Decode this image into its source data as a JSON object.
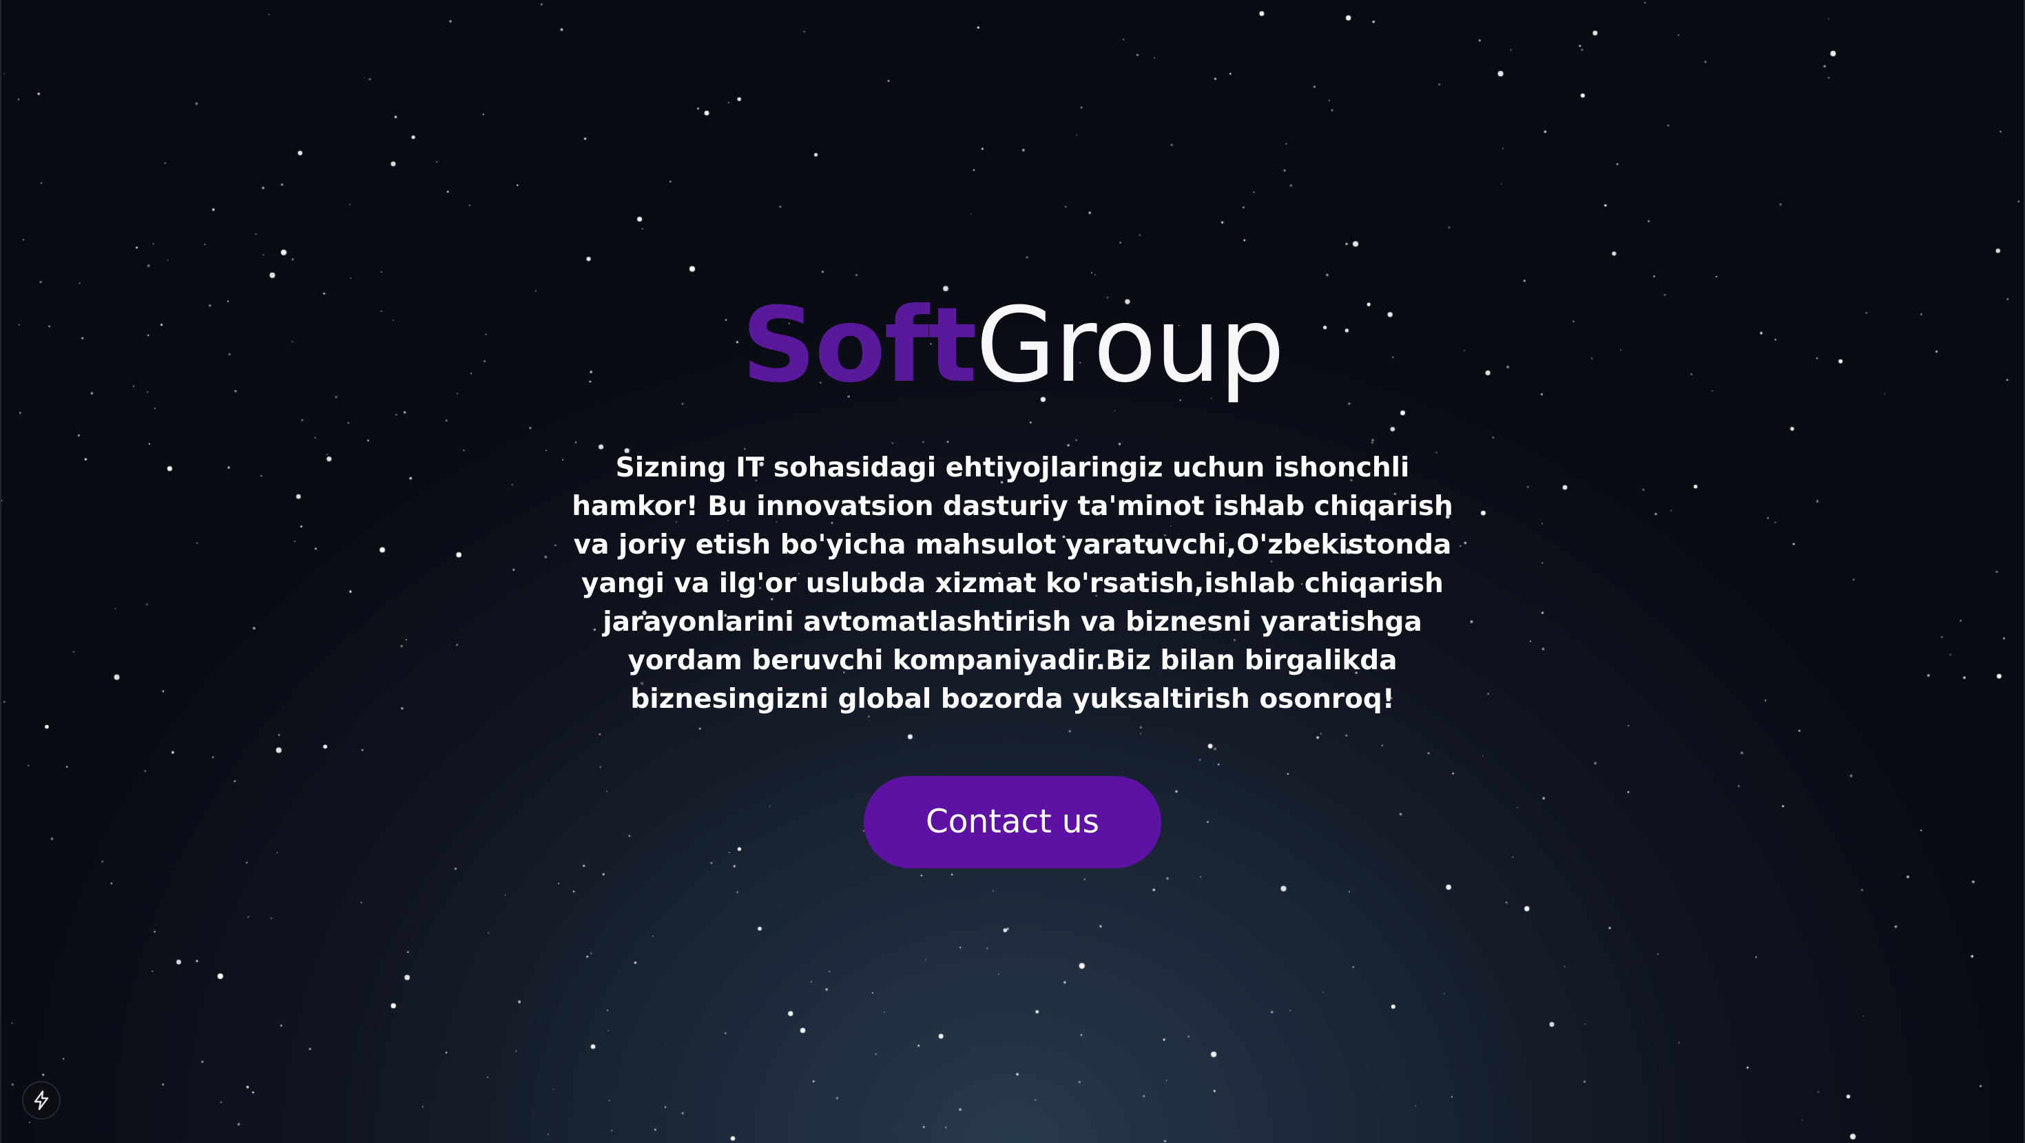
{
  "hero": {
    "brand_primary": "Soft",
    "brand_secondary": "Group",
    "tagline": "Sizning IT sohasidagi ehtiyojlaringiz uchun ishonchli hamkor! Bu innovatsion dasturiy ta'minot ishlab chiqarish va joriy etish bo'yicha mahsulot yaratuvchi,O'zbekistonda yangi va ilg'or uslubda xizmat ko'rsatish,ishlab chiqarish jarayonlarini avtomatlashtirish va biznesni yaratishga yordam beruvchi kompaniyadir.Biz bilan birgalikda biznesingizni global bozorda yuksaltirish osonroq!",
    "cta_label": "Contact us"
  },
  "dev_indicator": {
    "icon": "lightning-bolt-icon"
  },
  "colors": {
    "accent": "#5a189a",
    "button": "#5d12a3",
    "background_top": "#090b13",
    "background_bottom": "#273a4c",
    "text": "#ffffff"
  }
}
